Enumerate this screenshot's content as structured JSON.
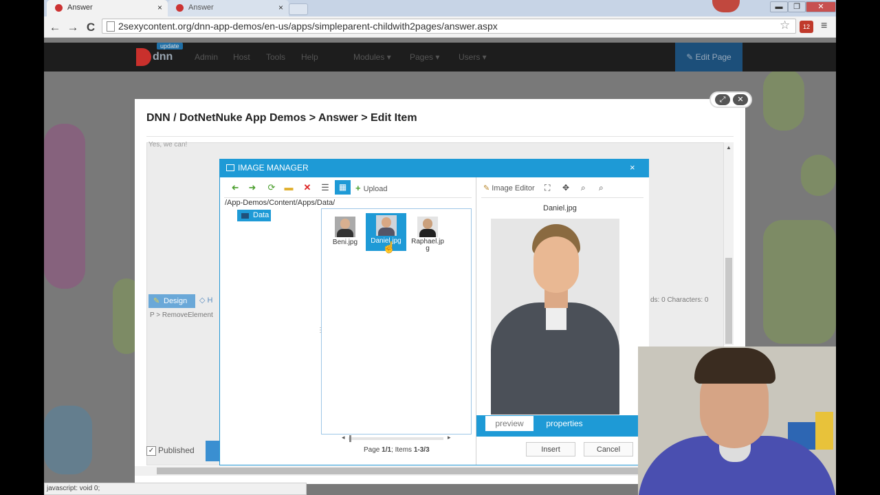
{
  "browser": {
    "tabs": [
      {
        "label": "Answer",
        "close": "×"
      },
      {
        "label": "Answer",
        "close": "×"
      }
    ],
    "window_controls": {
      "minimize": "▬",
      "maximize": "❐",
      "close": "✕"
    },
    "nav": {
      "back": "←",
      "forward": "→",
      "reload": "C"
    },
    "url": "2sexycontent.org/dnn-app-demos/en-us/apps/simpleparent-childwith2pages/answer.aspx",
    "star": "☆",
    "extension_badge": "12",
    "menu": "≡",
    "status": "javascript: void 0;"
  },
  "dnn": {
    "logo_text": "dnn",
    "update_badge": "update",
    "nav": [
      "Admin",
      "Host",
      "Tools",
      "Help",
      "Modules ▾",
      "Pages ▾",
      "Users ▾"
    ],
    "edit_page": "Edit Page"
  },
  "popup": {
    "breadcrumb": "DNN / DotNetNuke App Demos > Answer > Edit Item",
    "expand": "⤢",
    "close": "✕",
    "editor_text": "Yes, we can!",
    "design_label": "Design",
    "html_label": "H",
    "status_path": "P > RemoveElement",
    "word_count": "ds: 0   Characters: 0",
    "published_label": "Published",
    "published_check": "✓"
  },
  "image_manager": {
    "title": "IMAGE MANAGER",
    "close": "×",
    "toolbar": {
      "back": "➜",
      "forward": "➜",
      "refresh": "⟳",
      "new_folder": "▬",
      "delete": "✕",
      "list_view": "☰",
      "thumb_view": "▦",
      "upload": "Upload",
      "upload_plus": "+"
    },
    "path": "/App-Demos/Content/Apps/Data/",
    "tree_folder": "Data",
    "splitter": "⋮",
    "files": [
      {
        "name": "Beni.jpg"
      },
      {
        "name": "Daniel.jpg"
      },
      {
        "name": "Raphael.jpg"
      }
    ],
    "scroll_left": "◂",
    "scroll_right": "▸",
    "pager": {
      "prefix": "Page ",
      "page": "1/1",
      "mid": "; Items ",
      "items": "1-3/3"
    },
    "right_toolbar": {
      "image_editor": "Image Editor",
      "tools": [
        "⛶",
        "✥",
        "⌕",
        "⌕"
      ]
    },
    "preview_name": "Daniel.jpg",
    "tabs": {
      "preview": "preview",
      "properties": "properties"
    },
    "insert": "Insert",
    "cancel": "Cancel"
  }
}
